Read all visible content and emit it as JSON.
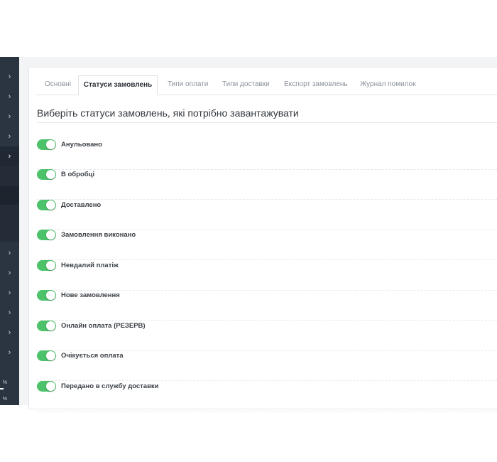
{
  "sidebar": {
    "chevron": "›",
    "percent_1": "%",
    "percent_2": "%",
    "active_index": 4
  },
  "tabs": [
    {
      "label": "Основні",
      "active": false
    },
    {
      "label": "Статуси замовлень",
      "active": true
    },
    {
      "label": "Типи оплати",
      "active": false
    },
    {
      "label": "Типи доставки",
      "active": false
    },
    {
      "label": "Експорт замовлень",
      "active": false
    },
    {
      "label": "Журнал помилок",
      "active": false
    }
  ],
  "heading": "Виберіть статуси замовлень, які потрібно завантажувати",
  "statuses": [
    {
      "label": "Анульовано",
      "enabled": true
    },
    {
      "label": "В обробці",
      "enabled": true
    },
    {
      "label": "Доставлено",
      "enabled": true
    },
    {
      "label": "Замовлення виконано",
      "enabled": true
    },
    {
      "label": "Невдалий платіж",
      "enabled": true
    },
    {
      "label": "Нове замовлення",
      "enabled": true
    },
    {
      "label": "Онлайн оплата (РЕЗЕРВ)",
      "enabled": true
    },
    {
      "label": "Очікується оплата",
      "enabled": true
    },
    {
      "label": "Передано в службу доставки",
      "enabled": true
    }
  ],
  "colors": {
    "toggle_on": "#4cc26a",
    "sidebar_bg": "#2b3542"
  }
}
